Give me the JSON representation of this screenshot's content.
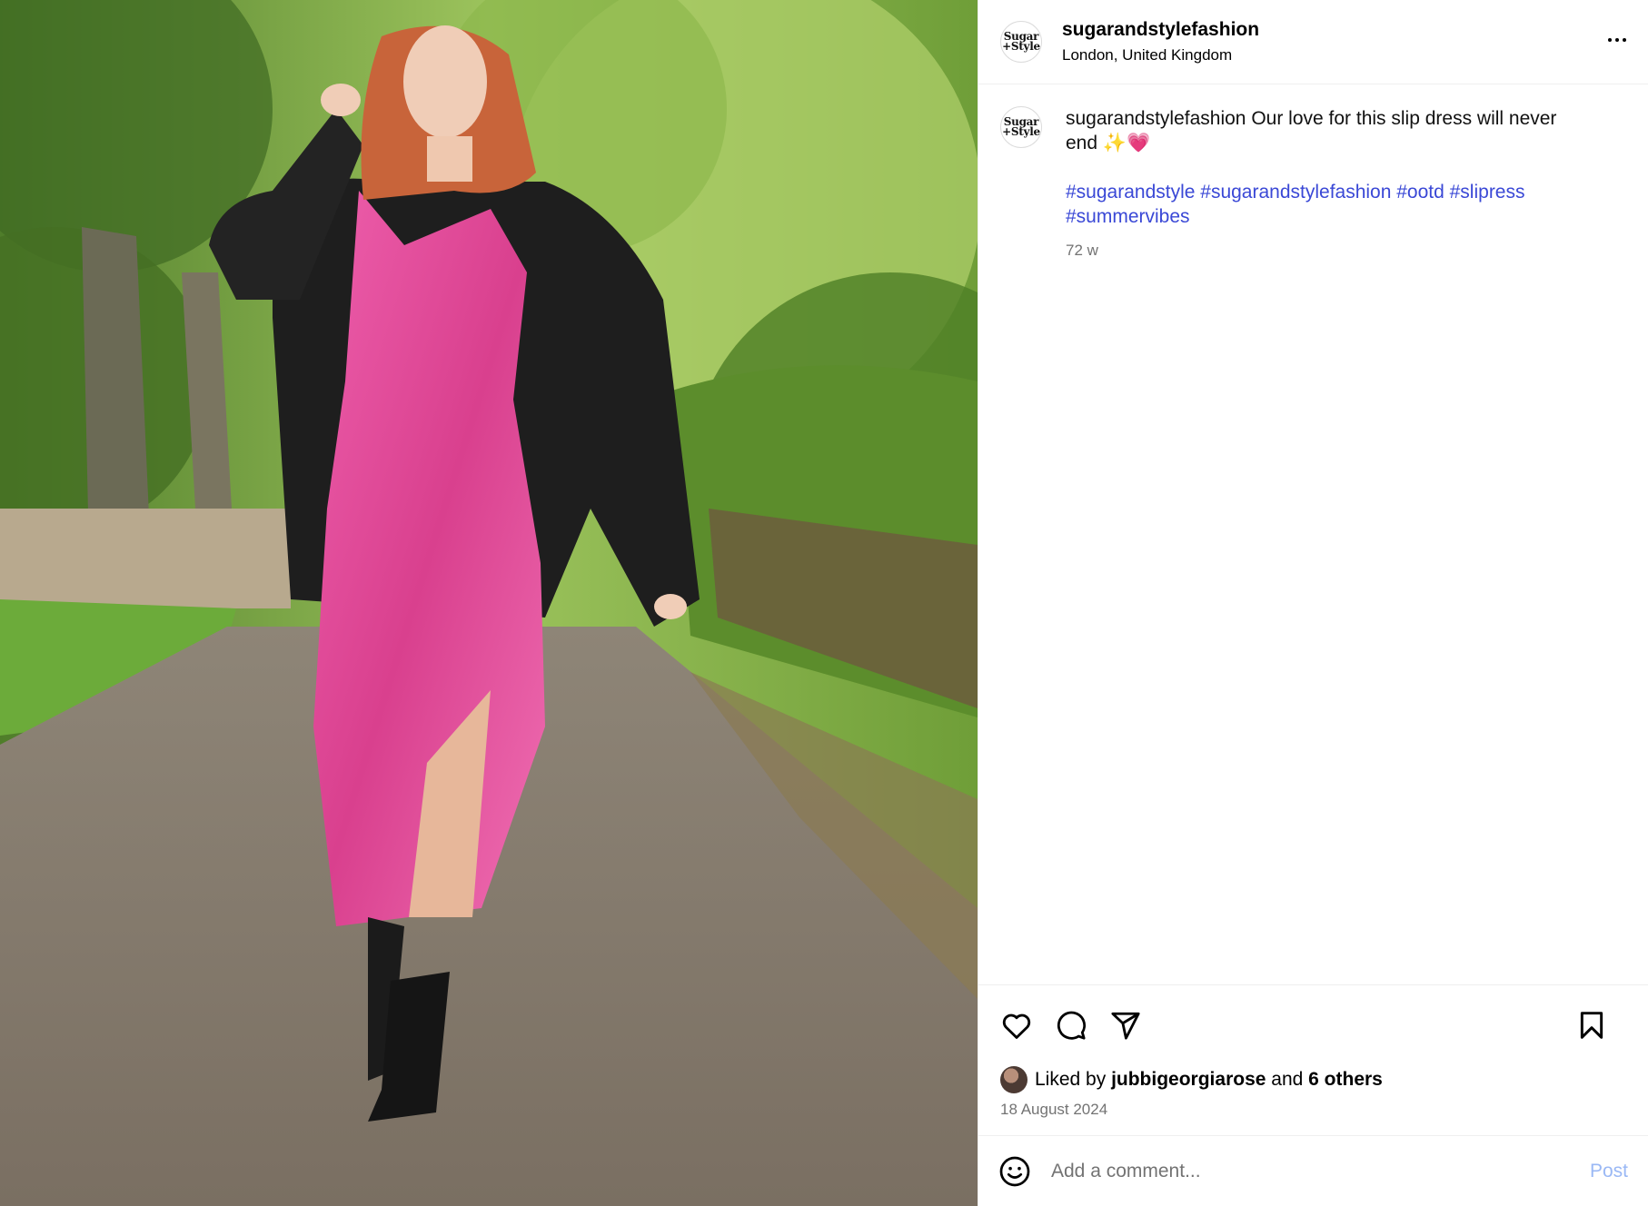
{
  "post": {
    "username": "sugarandstylefashion",
    "location": "London, United Kingdom",
    "avatar_text": [
      "Sugar",
      "+Style"
    ],
    "photo_alt": "Woman walking on a park path wearing a pink slip dress, black cardigan and cowboy boots"
  },
  "caption": {
    "username": "sugarandstylefashion",
    "text": "Our love for this slip dress will never end ✨💗",
    "hashtags": "#sugarandstyle #sugarandstylefashion #ootd #slipress #summervibes",
    "time_ago": "72 w"
  },
  "likes": {
    "prefix": "Liked by",
    "user": "jubbigeorgiarose",
    "middle": "and",
    "others": "6 others"
  },
  "date": "18 August 2024",
  "comment": {
    "placeholder": "Add a comment...",
    "post_label": "Post"
  },
  "icons": {
    "like": "heart-icon",
    "comment": "comment-icon",
    "share": "send-icon",
    "save": "bookmark-icon",
    "emoji": "emoji-icon",
    "more": "more-options-icon"
  },
  "colors": {
    "hashtag": "#3a48d6",
    "meta_gray": "#737373",
    "post_button": "#9ab8f5",
    "dress_pink": "#e24a9a"
  }
}
